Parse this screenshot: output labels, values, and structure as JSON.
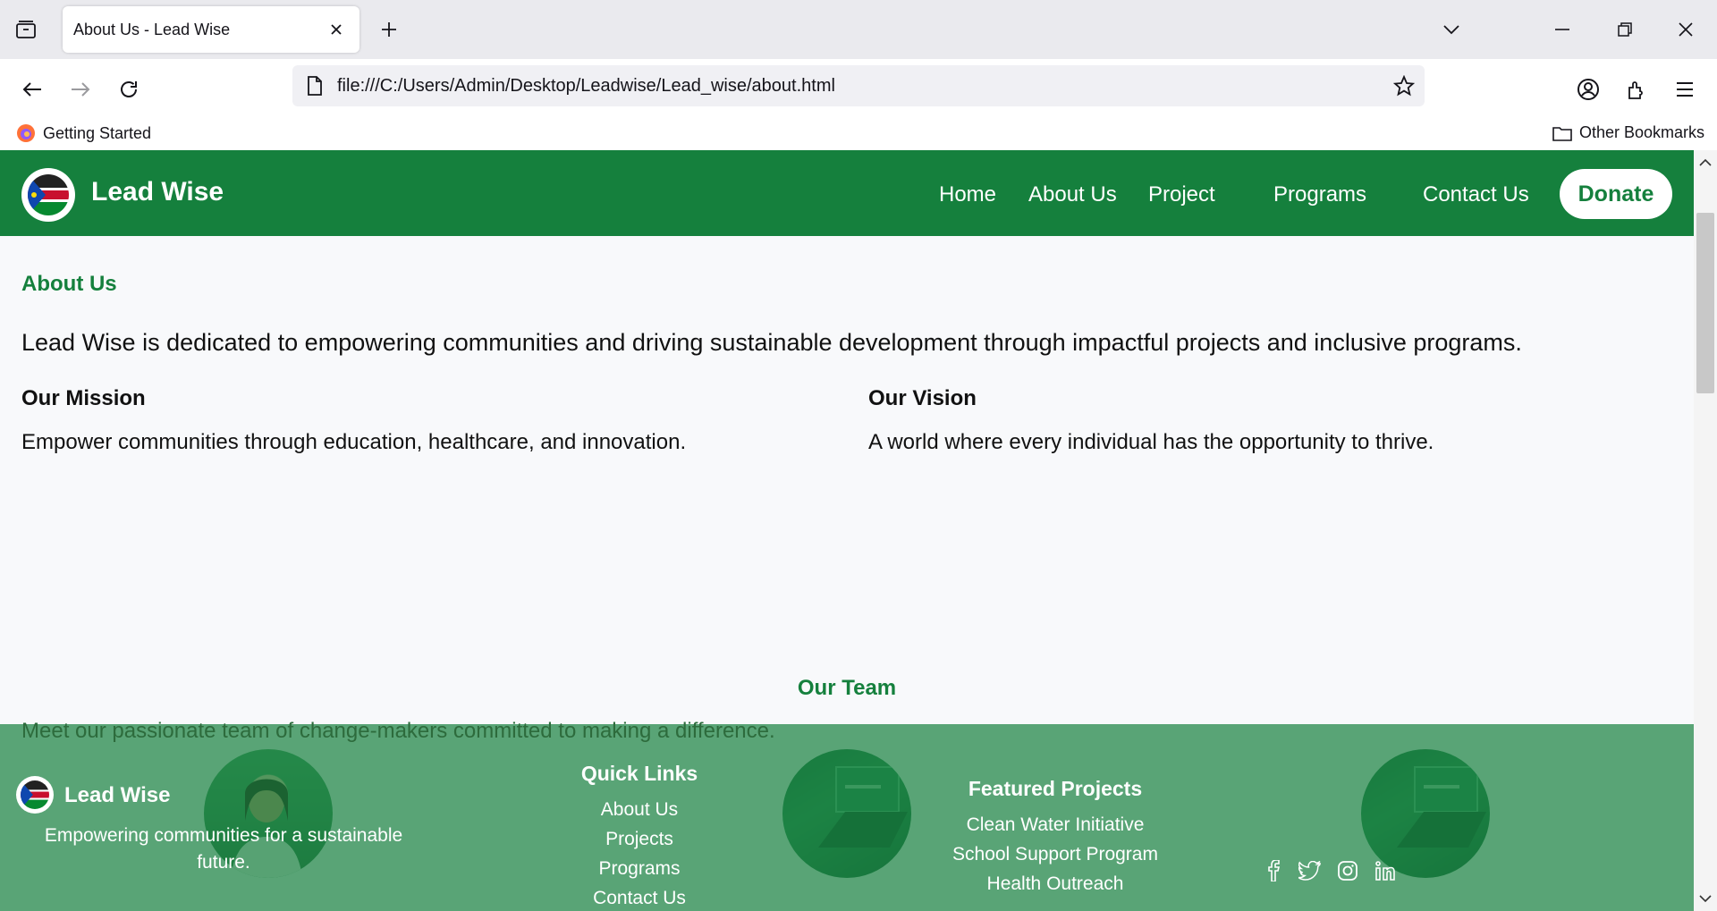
{
  "browser": {
    "tab_title": "About Us - Lead Wise",
    "url": "file:///C:/Users/Admin/Desktop/Leadwise/Lead_wise/about.html",
    "bookmarks": {
      "getting_started": "Getting Started",
      "other_bookmarks": "Other Bookmarks"
    }
  },
  "site": {
    "brand": "Lead Wise",
    "menu": [
      "Home",
      "About Us",
      "Project",
      "Programs",
      "Contact Us"
    ],
    "donate_label": "Donate",
    "brand_color": "#15803d"
  },
  "about": {
    "heading": "About Us",
    "intro": "Lead Wise is dedicated to empowering communities and driving sustainable development through impactful projects and inclusive programs.",
    "mission_title": "Our Mission",
    "mission_text": "Empower communities through education, healthcare, and innovation.",
    "vision_title": "Our Vision",
    "vision_text": "A world where every individual has the opportunity to thrive."
  },
  "team": {
    "heading": "Our Team",
    "subtitle": "Meet our passionate team of change-makers committed to making a difference."
  },
  "footer": {
    "brand": "Lead Wise",
    "tagline": "Empowering communities for a sustainable future.",
    "quick_links_title": "Quick Links",
    "quick_links": [
      "About Us",
      "Projects",
      "Programs",
      "Contact Us"
    ],
    "featured_title": "Featured Projects",
    "featured": [
      "Clean Water Initiative",
      "School Support Program",
      "Health Outreach"
    ],
    "social_icons": [
      "facebook-icon",
      "twitter-icon",
      "instagram-icon",
      "linkedin-icon"
    ]
  }
}
